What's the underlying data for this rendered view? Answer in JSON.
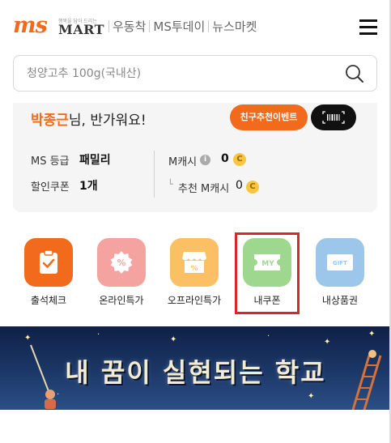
{
  "header": {
    "logo_ms": "ms",
    "logo_tagline": "행복을 담아 드리는",
    "logo_mart": "MART",
    "nav": [
      "우동착",
      "MS투데이",
      "뉴스마켓"
    ]
  },
  "search": {
    "placeholder": "청양고추 100g(국내산)"
  },
  "user_card": {
    "user_name": "박종근",
    "greeting_suffix": "님, 반가워요!",
    "event_button": "친구추천이벤트",
    "grade_label": "MS 등급",
    "grade_value": "패밀리",
    "coupon_label": "할인쿠폰",
    "coupon_value": "1개",
    "mcash_label": "M캐시",
    "mcash_value": "0",
    "referral_label": "추천 M캐시",
    "referral_value": "0",
    "coin_symbol": "C"
  },
  "menu": [
    {
      "label": "출석체크",
      "color": "#f26a1b",
      "icon": "clipboard-check-icon"
    },
    {
      "label": "온라인특가",
      "color": "#f4a3a0",
      "icon": "discount-tag-icon"
    },
    {
      "label": "오프라인특가",
      "color": "#fbc064",
      "icon": "store-icon"
    },
    {
      "label": "내쿠폰",
      "color": "#9ed88e",
      "icon": "coupon-icon",
      "badge": "MY"
    },
    {
      "label": "내상품권",
      "color": "#9cc6ea",
      "icon": "gift-card-icon",
      "badge": "GIFT"
    }
  ],
  "banner": {
    "title": "내 꿈이 실현되는 학교"
  }
}
